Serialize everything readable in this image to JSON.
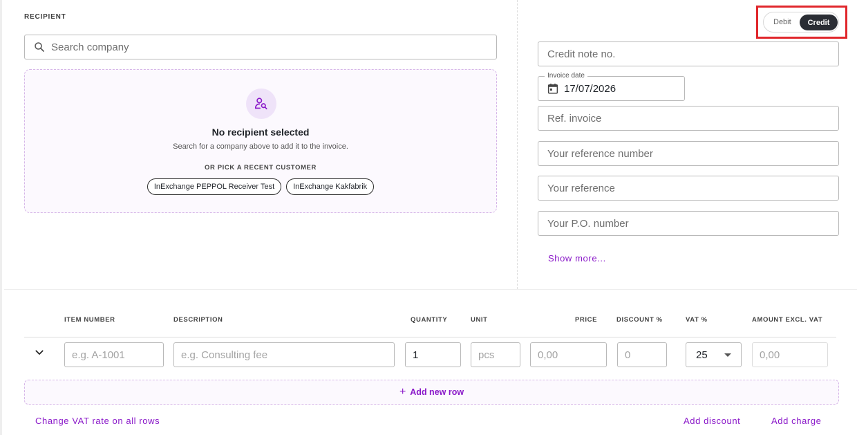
{
  "recipient": {
    "section_label": "RECIPIENT",
    "search_placeholder": "Search company",
    "empty_title": "No recipient selected",
    "empty_subtitle": "Search for a company above to add it to the invoice.",
    "recent_label": "OR PICK A RECENT CUSTOMER",
    "recent_customers": [
      "InExchange PEPPOL Receiver Test",
      "InExchange Kakfabrik"
    ]
  },
  "type_toggle": {
    "options": [
      "Debit",
      "Credit"
    ],
    "selected": "Credit"
  },
  "header_fields": {
    "credit_note_placeholder": "Credit note no.",
    "invoice_date_label": "Invoice date",
    "invoice_date_value": "17/07/2026",
    "ref_invoice_placeholder": "Ref. invoice",
    "your_reference_number_placeholder": "Your reference number",
    "your_reference_placeholder": "Your reference",
    "po_number_placeholder": "Your P.O. number",
    "show_more": "Show more..."
  },
  "table": {
    "columns": [
      "ITEM NUMBER",
      "DESCRIPTION",
      "QUANTITY",
      "UNIT",
      "PRICE",
      "DISCOUNT %",
      "VAT %",
      "AMOUNT EXCL. VAT"
    ],
    "row": {
      "item_number_placeholder": "e.g. A-1001",
      "description_placeholder": "e.g. Consulting fee",
      "quantity_value": "1",
      "unit_placeholder": "pcs",
      "price_placeholder": "0,00",
      "discount_placeholder": "0",
      "vat_value": "25",
      "amount_placeholder": "0,00"
    },
    "add_row_label": "Add new row"
  },
  "footer": {
    "change_vat": "Change VAT rate on all rows",
    "add_discount": "Add discount",
    "add_charge": "Add charge"
  },
  "colors": {
    "accent": "#8a19c9",
    "highlight": "#e0262b",
    "toggle_active": "#2a2d34"
  }
}
